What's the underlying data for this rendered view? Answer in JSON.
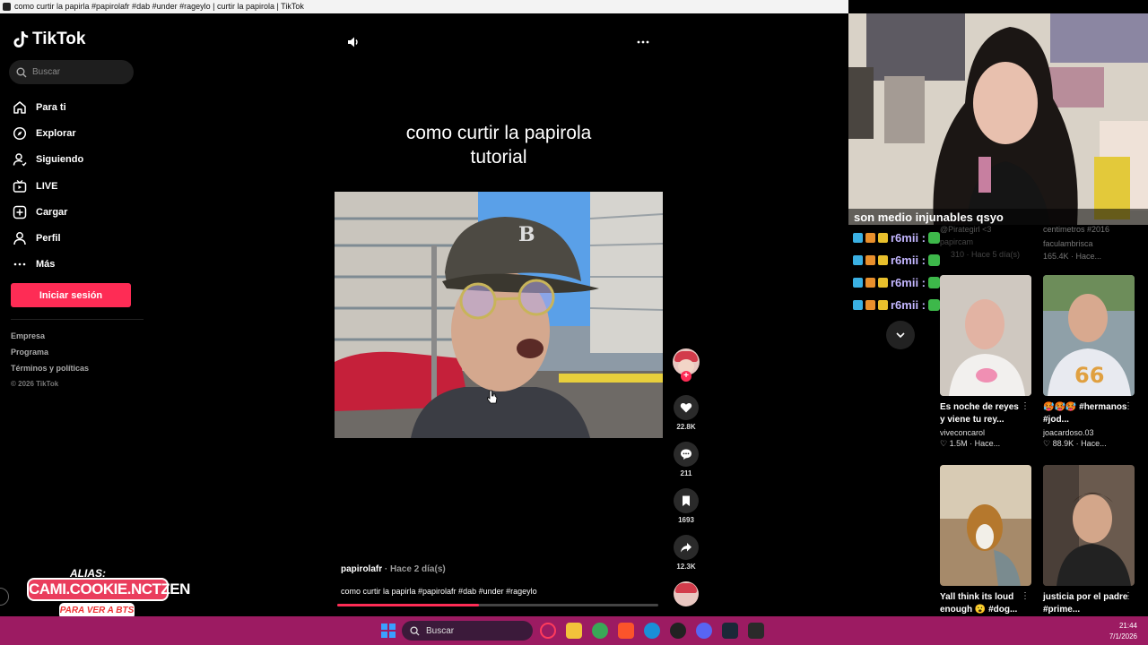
{
  "window": {
    "title": "como curtir la papirla #papirolafr #dab #under #rageylo | curtir la papirola | TikTok"
  },
  "sidebar": {
    "logo": "TikTok",
    "search_placeholder": "Buscar",
    "nav": [
      {
        "label": "Para ti",
        "icon": "home-icon"
      },
      {
        "label": "Explorar",
        "icon": "compass-icon"
      },
      {
        "label": "Siguiendo",
        "icon": "following-icon"
      },
      {
        "label": "LIVE",
        "icon": "live-icon"
      },
      {
        "label": "Cargar",
        "icon": "upload-icon"
      },
      {
        "label": "Perfil",
        "icon": "profile-icon"
      },
      {
        "label": "Más",
        "icon": "more-dots-icon"
      }
    ],
    "login_label": "Iniciar sesión",
    "footer": [
      "Empresa",
      "Programa",
      "Términos y políticas"
    ],
    "copyright": "© 2026 TikTok"
  },
  "video": {
    "overlay_title_line1": "como curtir la papirola",
    "overlay_title_line2": "tutorial",
    "author": "papirolafr",
    "posted": " · Hace 2 día(s)",
    "caption": "como curtir la papirla #papirolafr #dab #under #rageylo",
    "progress": 0.44,
    "actions": {
      "likes": "22.8K",
      "comments": "211",
      "saves": "1693",
      "shares": "12.3K"
    }
  },
  "chat": {
    "top_message": "son medio injunables qsyo",
    "messages": [
      {
        "user": "r6mii :"
      },
      {
        "user": "r6mii :"
      },
      {
        "user": "r6mii :"
      },
      {
        "user": "r6mii :"
      }
    ]
  },
  "recommendations": {
    "partial_left": {
      "title": "@Pirategirl <3",
      "author": "papircam",
      "stats": "310 · Hace 5 día(s)"
    },
    "partial_right": {
      "title": "centimetros #2016",
      "author": "faculambrisca",
      "stats": "165.4K · Hace..."
    },
    "cards": [
      {
        "title": "Es noche de reyes y viene tu rey...",
        "author": "viveconcarol",
        "stats": "♡ 1.5M · Hace..."
      },
      {
        "title": "🥵🥵🥵 #hermanos #jod...",
        "author": "joacardoso.03",
        "stats": "♡ 88.9K · Hace..."
      },
      {
        "title": "Yall think its loud enough 😮 #dog...",
        "author": "",
        "stats": ""
      },
      {
        "title": "justicia por el padre #prime...",
        "author": "",
        "stats": ""
      }
    ]
  },
  "stream_overlay": {
    "alias": "ALIAS:",
    "name": "CAMI.COOKIE.NCTZEN",
    "sub": "PARA VER A BTS"
  },
  "taskbar": {
    "search_label": "Buscar",
    "time": "21:44",
    "date": "7/1/2026"
  },
  "colors": {
    "accent": "#fe2c55",
    "taskbar": "#9c1b62",
    "chat_user": "#c3b6ff"
  }
}
